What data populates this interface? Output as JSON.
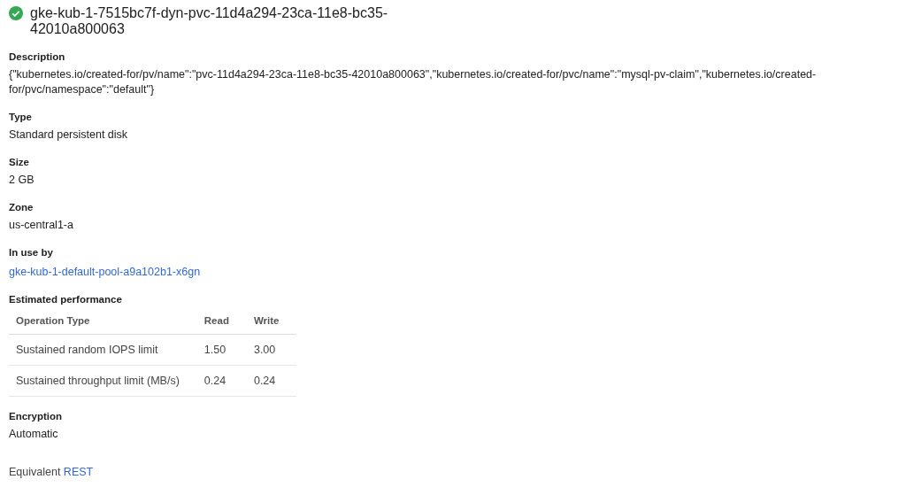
{
  "header": {
    "title": "gke-kub-1-7515bc7f-dyn-pvc-11d4a294-23ca-11e8-bc35-42010a800063",
    "success": true
  },
  "sections": [
    {
      "kind": "text",
      "label": "Description",
      "value": "{\"kubernetes.io/created-for/pv/name\":\"pvc-11d4a294-23ca-11e8-bc35-42010a800063\",\"kubernetes.io/created-for/pvc/name\":\"mysql-pv-claim\",\"kubernetes.io/created-for/pvc/namespace\":\"default\"}"
    },
    {
      "kind": "text",
      "label": "Type",
      "value": "Standard persistent disk"
    },
    {
      "kind": "text",
      "label": "Size",
      "value": "2 GB"
    },
    {
      "kind": "text",
      "label": "Zone",
      "value": "us-central1-a"
    },
    {
      "kind": "link",
      "label": "In use by",
      "value": "gke-kub-1-default-pool-a9a102b1-x6gn"
    },
    {
      "kind": "table",
      "label": "Estimated performance",
      "columns": [
        "Operation Type",
        "Read",
        "Write"
      ],
      "rows": [
        [
          "Sustained random IOPS limit",
          "1.50",
          "3.00"
        ],
        [
          "Sustained throughput limit (MB/s)",
          "0.24",
          "0.24"
        ]
      ]
    },
    {
      "kind": "text",
      "label": "Encryption",
      "value": "Automatic"
    }
  ],
  "footer": {
    "text": "Equivalent",
    "link": "REST"
  }
}
